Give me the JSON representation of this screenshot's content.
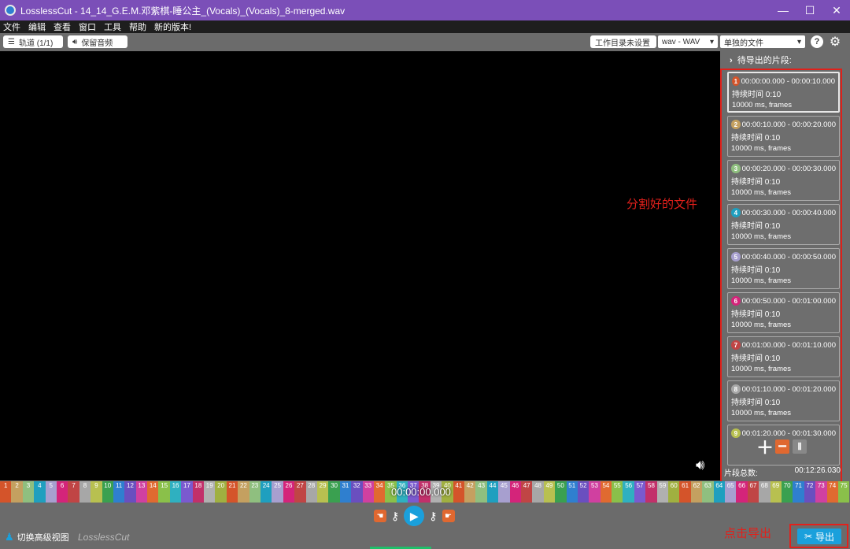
{
  "window": {
    "title": "LosslessCut - 14_14_G.E.M.邓紫棋-睡公主_(Vocals)_(Vocals)_8-merged.wav",
    "minimize": "—",
    "maximize": "☐",
    "close": "✕"
  },
  "menu": [
    "文件",
    "编辑",
    "查看",
    "窗口",
    "工具",
    "帮助",
    "新的版本!"
  ],
  "toolbar": {
    "tracks_label": "轨道 (1/1)",
    "keep_audio_label": "保留音频",
    "workdir_label": "工作目录未设置",
    "format_value": "wav - WAV",
    "output_mode_value": "单独的文件",
    "help_label": "?",
    "settings_icon": "gear-icon"
  },
  "sidebar": {
    "header": "待导出的片段:",
    "segments": [
      {
        "num": "1",
        "color": "#d4542a",
        "range": "00:00:00.000 - 00:00:10.000",
        "duration": "持续时间 0:10",
        "frames": "10000 ms, frames"
      },
      {
        "num": "2",
        "color": "#c4a060",
        "range": "00:00:10.000 - 00:00:20.000",
        "duration": "持续时间 0:10",
        "frames": "10000 ms, frames"
      },
      {
        "num": "3",
        "color": "#8fbf7f",
        "range": "00:00:20.000 - 00:00:30.000",
        "duration": "持续时间 0:10",
        "frames": "10000 ms, frames"
      },
      {
        "num": "4",
        "color": "#1f9fbf",
        "range": "00:00:30.000 - 00:00:40.000",
        "duration": "持续时间 0:10",
        "frames": "10000 ms, frames"
      },
      {
        "num": "5",
        "color": "#a79fcf",
        "range": "00:00:40.000 - 00:00:50.000",
        "duration": "持续时间 0:10",
        "frames": "10000 ms, frames"
      },
      {
        "num": "6",
        "color": "#d4247a",
        "range": "00:00:50.000 - 00:01:00.000",
        "duration": "持续时间 0:10",
        "frames": "10000 ms, frames"
      },
      {
        "num": "7",
        "color": "#c04545",
        "range": "00:01:00.000 - 00:01:10.000",
        "duration": "持续时间 0:10",
        "frames": "10000 ms, frames"
      },
      {
        "num": "8",
        "color": "#a7a7a7",
        "range": "00:01:10.000 - 00:01:20.000",
        "duration": "持续时间 0:10",
        "frames": "10000 ms, frames"
      },
      {
        "num": "9",
        "color": "#b8c050",
        "range": "00:01:20.000 - 00:01:30.000",
        "duration": "",
        "frames": ""
      }
    ],
    "count_label": "片段总数:",
    "total_duration": "00:12:26.030"
  },
  "annotations": {
    "split_files": "分割好的文件",
    "click_export": "点击导出"
  },
  "timeline": {
    "ticks": [
      "1",
      "2",
      "3",
      "4",
      "5",
      "6",
      "7",
      "8",
      "9",
      "10",
      "11",
      "12",
      "13",
      "14",
      "15",
      "16",
      "17",
      "18",
      "19",
      "20",
      "21",
      "22",
      "23",
      "24",
      "25",
      "26",
      "27",
      "28",
      "29",
      "30",
      "31",
      "32",
      "33",
      "34",
      "35",
      "36",
      "37",
      "38",
      "39",
      "40",
      "41",
      "42",
      "43",
      "44",
      "45",
      "46",
      "47",
      "48",
      "49",
      "50",
      "51",
      "52",
      "53",
      "54",
      "55",
      "56",
      "57",
      "58",
      "59",
      "60",
      "61",
      "62",
      "63",
      "64",
      "65",
      "66",
      "67",
      "68",
      "69",
      "70",
      "71",
      "72",
      "73",
      "74",
      "75"
    ],
    "colors": [
      "#d4542a",
      "#c4a060",
      "#8fbf7f",
      "#1f9fbf",
      "#a79fcf",
      "#d4247a",
      "#c04545",
      "#a7a7a7",
      "#b8c050",
      "#3aa050",
      "#2f7fcf",
      "#6a4fbf",
      "#d040a0",
      "#e06a30",
      "#8ac04a",
      "#2fb0c0",
      "#7a5acf",
      "#c2306a",
      "#b0b0b0",
      "#a0b040"
    ],
    "current_time": "00:00:00.000"
  },
  "bottom": {
    "advanced_view_label": "切换高级视图",
    "brand": "LosslessCut",
    "export_label": "导出"
  }
}
